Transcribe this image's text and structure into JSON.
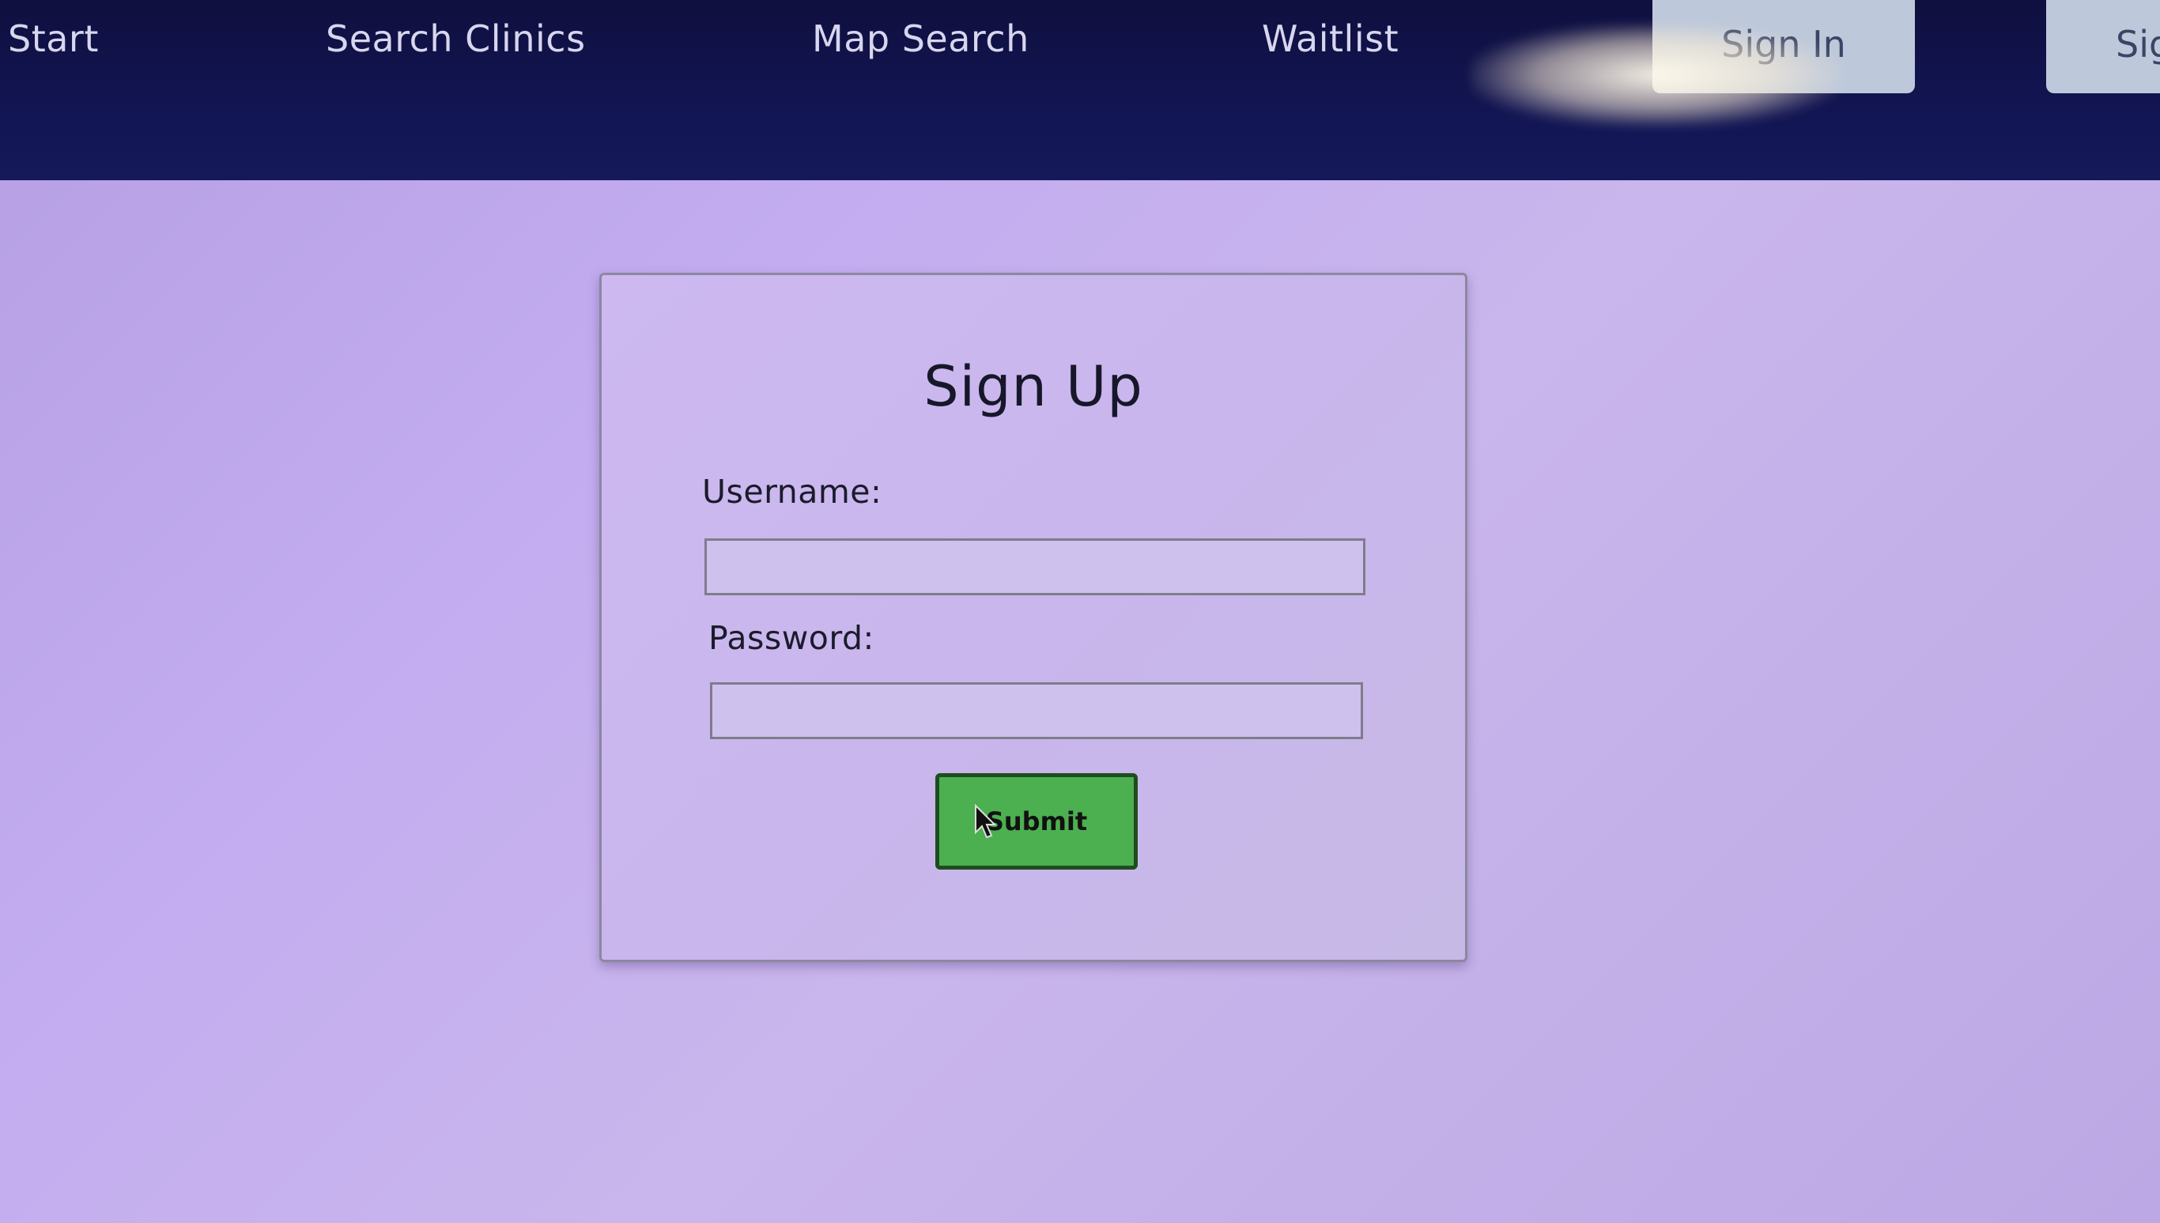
{
  "nav": {
    "start": "Start",
    "search_clinics": "Search Clinics",
    "map_search": "Map Search",
    "waitlist": "Waitlist",
    "sign_in": "Sign In",
    "sign_up_partial": "Sig"
  },
  "form": {
    "title": "Sign Up",
    "username_label": "Username:",
    "username_value": "",
    "password_label": "Password:",
    "password_value": "",
    "submit_label": "Submit"
  },
  "colors": {
    "nav_background": "#121552",
    "page_background": "#c3acf0",
    "submit_button": "#4caf50",
    "nav_tab": "#bdc8da"
  },
  "icons": {
    "cursor": "mouse-pointer-icon"
  }
}
